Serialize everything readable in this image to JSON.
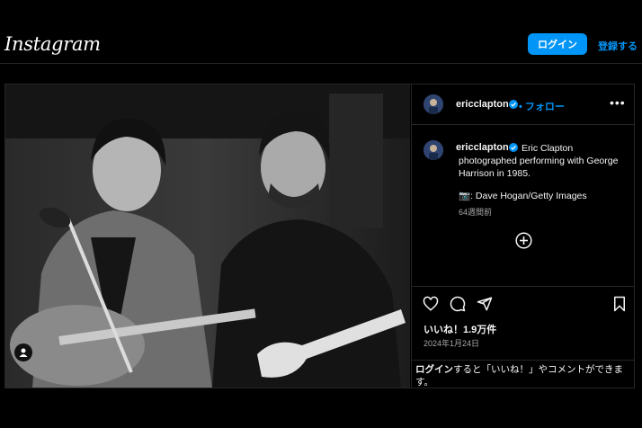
{
  "header": {
    "logo": "Instagram",
    "login_button": "ログイン",
    "signup_link": "登録する"
  },
  "post": {
    "username": "ericclapton",
    "follow_label": "• フォロー",
    "more_icon": "more-horizontal-icon",
    "caption_text": "Eric Clapton photographed performing with George Harrison in 1985.",
    "credit": "📷: Dave Hogan/Getty Images",
    "time_ago": "64週間前",
    "likes": "いいね！1.9万件",
    "date": "2024年1月24日",
    "login_prompt_link": "ログイン",
    "login_prompt_rest": "すると「いいね！」やコメントができます。",
    "icons": [
      "heart-icon",
      "comment-icon",
      "share-icon",
      "bookmark-icon",
      "add-comment-icon",
      "verified-badge-icon",
      "user-tag-icon"
    ],
    "colors": {
      "accent": "#0095f6",
      "background": "#000000",
      "border": "#262626",
      "secondary_text": "#a8a8a8"
    }
  }
}
